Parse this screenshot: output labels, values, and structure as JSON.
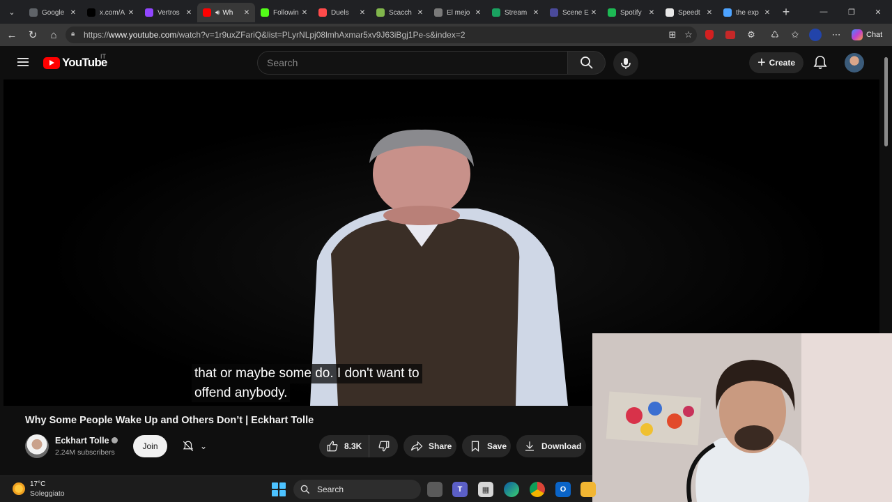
{
  "browser": {
    "tabs": [
      {
        "title": "Google",
        "favicon_color": "#5f6368",
        "active": false
      },
      {
        "title": "x.com/A",
        "favicon_color": "#000000",
        "active": false
      },
      {
        "title": "Vertros",
        "favicon_color": "#9146ff",
        "active": false
      },
      {
        "title": "Wh",
        "favicon_color": "#ff0000",
        "active": true
      },
      {
        "title": "Followin",
        "favicon_color": "#53fc18",
        "active": false
      },
      {
        "title": "Duels",
        "favicon_color": "#ff4b4b",
        "active": false
      },
      {
        "title": "Scacch",
        "favicon_color": "#81b64c",
        "active": false
      },
      {
        "title": "El mejo",
        "favicon_color": "#7a7a7a",
        "active": false
      },
      {
        "title": "Stream",
        "favicon_color": "#1aa260",
        "active": false
      },
      {
        "title": "Scene E",
        "favicon_color": "#4a4a9a",
        "active": false
      },
      {
        "title": "Spotify",
        "favicon_color": "#1db954",
        "active": false
      },
      {
        "title": "Speedt",
        "favicon_color": "#e8e8e8",
        "active": false
      },
      {
        "title": "the exp",
        "favicon_color": "#4da3ff",
        "active": false
      }
    ],
    "url_prefix": "https://",
    "url_host": "www.youtube.com",
    "url_path": "/watch?v=1r9uxZFariQ&list=PLyrNLpj08lmhAxmar5xv9J63iBgj1Pe-s&index=2",
    "chat_label": "Chat"
  },
  "youtube": {
    "logo_text": "YouTube",
    "country_code": "IT",
    "search_placeholder": "Search",
    "create_label": "Create"
  },
  "video": {
    "caption_line1": "that or maybe some do. I don't want to",
    "caption_line2": "offend anybody.",
    "title": "Why Some People Wake Up and Others Don’t | Eckhart Tolle",
    "channel_name": "Eckhart Tolle",
    "subscribers": "2.24M subscribers",
    "join_label": "Join",
    "likes": "8.3K",
    "share_label": "Share",
    "save_label": "Save",
    "download_label": "Download"
  },
  "taskbar": {
    "temperature": "17°C",
    "weather": "Soleggiato",
    "search_label": "Search"
  },
  "colors": {
    "accent_red": "#ff0000",
    "background": "#0f0f0f",
    "button_bg": "#272727"
  }
}
